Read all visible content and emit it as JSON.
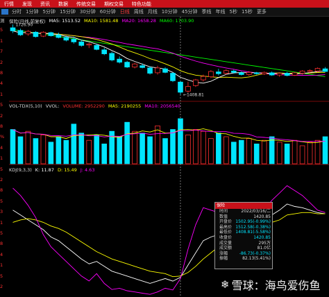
{
  "menu": [
    "行情",
    "发现",
    "资讯",
    "数据",
    "传统交易",
    "期权交易",
    "特色功能"
  ],
  "periods": {
    "items": [
      "分时",
      "1分钟",
      "5分钟",
      "15分钟",
      "30分钟",
      "60分钟",
      "日线",
      "周线",
      "月线",
      "10分钟",
      "45分钟",
      "季线",
      "年线",
      "5秒",
      "15秒",
      "更多"
    ],
    "active_index": 6
  },
  "left_labels": [
    "测",
    "5",
    "1",
    "7",
    "2",
    "8",
    "4",
    "1",
    "5",
    "2",
    "8",
    "%",
    "4",
    "1",
    "5",
    "2",
    "8",
    "5",
    "3",
    "1",
    "5",
    "8",
    "4",
    "1",
    "5",
    "2"
  ],
  "price_header": {
    "name": "保险(日线,前复权)",
    "ma5": "MA5: 1513.52",
    "ma10": "MA10: 1581.48",
    "ma20": "MA20: 1658.28",
    "ma60": "MA60: 1703.90",
    "high_mark": "1726.90",
    "low_mark": "1408.81"
  },
  "vol_header": {
    "name": "VOL-TDX(5,10)",
    "vvol": "VVOL:",
    "volume": "VOLUME: 2952290",
    "ma5": "MA5: 2190255",
    "ma10": "MA10: 2056540"
  },
  "kdj_header": {
    "name": "KDJ(9,3,3)",
    "k": "K: 11.87",
    "d": "D: 15.49",
    "j": "J: 4.63"
  },
  "colors": {
    "up": "#ff3030",
    "down": "#00e5ff",
    "ma5": "#ffffff",
    "ma10": "#ffff00",
    "ma20": "#ff00ff",
    "ma60": "#00ff00",
    "menubar": "#c8111a"
  },
  "chart_data": {
    "type": "candlestick",
    "price_axis": [
      1408.81,
      1726.9
    ],
    "candles": [
      {
        "o": 1712,
        "h": 1726.9,
        "l": 1688,
        "c": 1698
      },
      {
        "o": 1700,
        "h": 1708,
        "l": 1675,
        "c": 1680
      },
      {
        "o": 1684,
        "h": 1702,
        "l": 1676,
        "c": 1696
      },
      {
        "o": 1692,
        "h": 1697,
        "l": 1668,
        "c": 1672
      },
      {
        "o": 1674,
        "h": 1696,
        "l": 1670,
        "c": 1692
      },
      {
        "o": 1690,
        "h": 1694,
        "l": 1672,
        "c": 1676
      },
      {
        "o": 1680,
        "h": 1690,
        "l": 1664,
        "c": 1668
      },
      {
        "o": 1668,
        "h": 1676,
        "l": 1650,
        "c": 1656
      },
      {
        "o": 1660,
        "h": 1672,
        "l": 1640,
        "c": 1648
      },
      {
        "o": 1648,
        "h": 1658,
        "l": 1626,
        "c": 1632
      },
      {
        "o": 1634,
        "h": 1644,
        "l": 1620,
        "c": 1638
      },
      {
        "o": 1632,
        "h": 1640,
        "l": 1610,
        "c": 1614
      },
      {
        "o": 1612,
        "h": 1622,
        "l": 1588,
        "c": 1594
      },
      {
        "o": 1596,
        "h": 1604,
        "l": 1560,
        "c": 1566
      },
      {
        "o": 1570,
        "h": 1582,
        "l": 1550,
        "c": 1556
      },
      {
        "o": 1556,
        "h": 1562,
        "l": 1530,
        "c": 1534
      },
      {
        "o": 1534,
        "h": 1554,
        "l": 1528,
        "c": 1548
      },
      {
        "o": 1540,
        "h": 1550,
        "l": 1528,
        "c": 1532
      },
      {
        "o": 1530,
        "h": 1538,
        "l": 1500,
        "c": 1506
      },
      {
        "o": 1508,
        "h": 1540,
        "l": 1500,
        "c": 1530
      },
      {
        "o": 1526,
        "h": 1533,
        "l": 1506,
        "c": 1510
      },
      {
        "o": 1506,
        "h": 1510,
        "l": 1466,
        "c": 1472
      },
      {
        "o": 1466,
        "h": 1470,
        "l": 1408.81,
        "c": 1420
      },
      {
        "o": 1425,
        "h": 1468,
        "l": 1418,
        "c": 1446
      },
      {
        "o": 1450,
        "h": 1480,
        "l": 1444,
        "c": 1476
      },
      {
        "o": 1476,
        "h": 1500,
        "l": 1468,
        "c": 1492
      },
      {
        "o": 1490,
        "h": 1520,
        "l": 1484,
        "c": 1514
      },
      {
        "o": 1512,
        "h": 1526,
        "l": 1496,
        "c": 1504
      },
      {
        "o": 1506,
        "h": 1524,
        "l": 1500,
        "c": 1518
      },
      {
        "o": 1516,
        "h": 1522,
        "l": 1504,
        "c": 1510
      },
      {
        "o": 1508,
        "h": 1514,
        "l": 1496,
        "c": 1500
      },
      {
        "o": 1500,
        "h": 1516,
        "l": 1494,
        "c": 1510
      },
      {
        "o": 1508,
        "h": 1512,
        "l": 1500,
        "c": 1504
      },
      {
        "o": 1503,
        "h": 1514,
        "l": 1498,
        "c": 1510
      },
      {
        "o": 1508,
        "h": 1514,
        "l": 1494,
        "c": 1498
      },
      {
        "o": 1498,
        "h": 1510,
        "l": 1490,
        "c": 1506
      },
      {
        "o": 1506,
        "h": 1512,
        "l": 1492,
        "c": 1496
      },
      {
        "o": 1497,
        "h": 1512,
        "l": 1494,
        "c": 1508
      },
      {
        "o": 1506,
        "h": 1520,
        "l": 1500,
        "c": 1516
      },
      {
        "o": 1514,
        "h": 1524,
        "l": 1506,
        "c": 1518
      },
      {
        "o": 1516,
        "h": 1532,
        "l": 1510,
        "c": 1528
      },
      {
        "o": 1526,
        "h": 1534,
        "l": 1512,
        "c": 1514
      }
    ],
    "volume": [
      1.9,
      1.5,
      1.8,
      1.4,
      1.6,
      1.2,
      1.5,
      1.3,
      2.2,
      1.7,
      1.3,
      1.6,
      1.1,
      1.8,
      1.5,
      2.3,
      1.8,
      1.7,
      1.5,
      2.1,
      1.4,
      1.9,
      2.5,
      1.6,
      1.9,
      1.8,
      1.4,
      1.7,
      1.5,
      1.2,
      1.3,
      1.4,
      1.1,
      1.3,
      1.5,
      1.2,
      1.1,
      1.3,
      1.0,
      1.2,
      1.3,
      1.5
    ],
    "volume_axis": [
      0,
      3.0
    ],
    "kdj_axis": [
      0,
      100
    ],
    "kdj": {
      "k": [
        70,
        66,
        62,
        58,
        54,
        48,
        45,
        40,
        35,
        30,
        26,
        28,
        24,
        20,
        18,
        16,
        14,
        12,
        10,
        12,
        14,
        11.87,
        15,
        25,
        35,
        45,
        48,
        50,
        52,
        55,
        57,
        58,
        60,
        62,
        66,
        70,
        75,
        73,
        72,
        70,
        68,
        67
      ],
      "d": [
        60,
        62,
        63,
        62,
        60,
        57,
        55,
        52,
        48,
        44,
        40,
        36,
        33,
        30,
        28,
        26,
        24,
        22,
        20,
        19,
        18,
        15.49,
        16,
        19,
        24,
        30,
        35,
        40,
        44,
        48,
        51,
        53,
        55,
        57,
        60,
        62,
        66,
        67,
        68,
        68,
        67,
        67
      ],
      "j": [
        88,
        82,
        74,
        64,
        50,
        40,
        34,
        28,
        22,
        16,
        12,
        18,
        10,
        5,
        6,
        4,
        3,
        2,
        1,
        3,
        6,
        4.63,
        14,
        38,
        58,
        72,
        70,
        68,
        66,
        66,
        66,
        62,
        66,
        70,
        78,
        84,
        90,
        86,
        82,
        76,
        70,
        68
      ]
    }
  },
  "popup": {
    "title": "保险",
    "rows": [
      {
        "k": "时间",
        "v": "2022/03/16/二",
        "c": "#dddddd"
      },
      {
        "k": "数值",
        "v": "1420.85",
        "c": "#dddddd"
      },
      {
        "k": "开盘价",
        "v": "1502.95(-0.99%)",
        "c": "#00e5ff"
      },
      {
        "k": "最高价",
        "v": "1512.58(-0.38%)",
        "c": "#00e5ff"
      },
      {
        "k": "最低价",
        "v": "1408.81(-5.58%)",
        "c": "#00e5ff"
      },
      {
        "k": "收盘价",
        "v": "1420.85",
        "c": "#00e5ff"
      },
      {
        "k": "成交量",
        "v": "295万",
        "c": "#dddddd"
      },
      {
        "k": "成交额",
        "v": "81.0亿",
        "c": "#dddddd"
      },
      {
        "k": "涨幅",
        "v": "-86.73(-0.37%)",
        "c": "#00e5ff"
      },
      {
        "k": "振幅",
        "v": "82.13(5.41%)",
        "c": "#dddddd"
      }
    ]
  },
  "watermark": "雪球：海鸟爱伤鱼"
}
